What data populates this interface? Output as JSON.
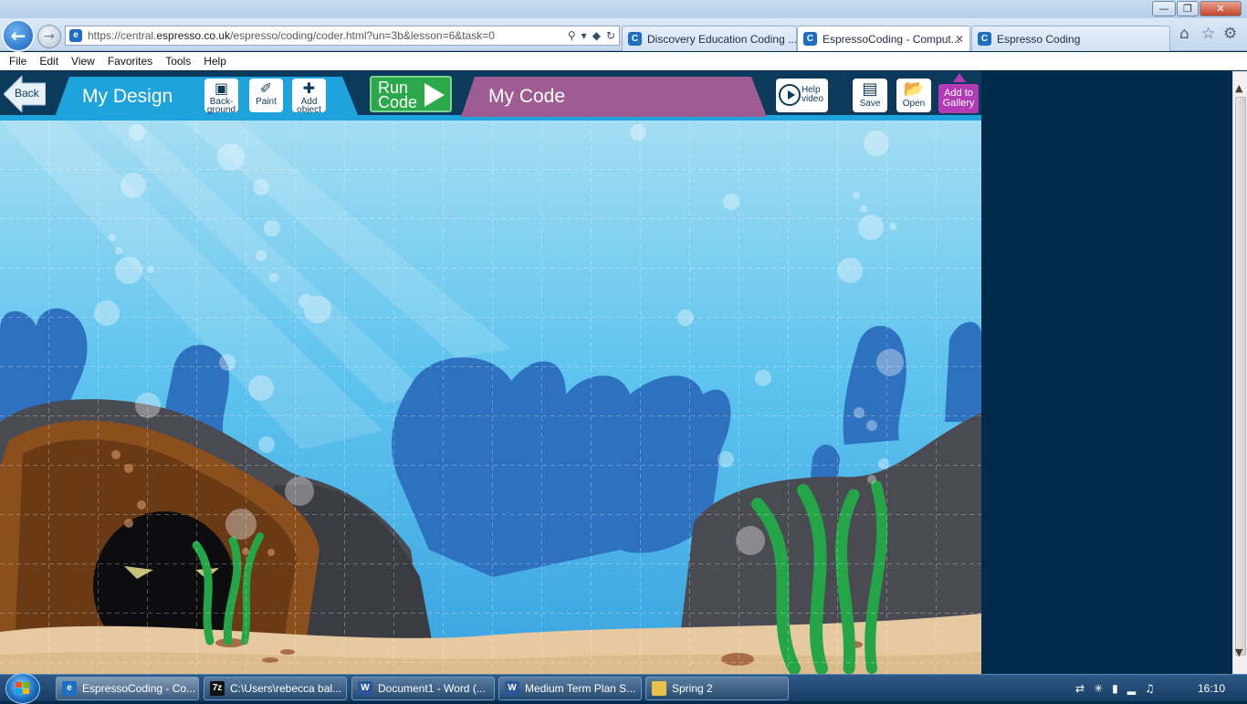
{
  "browser": {
    "url_prefix": "https://central.",
    "url_domain": "espresso.co.uk",
    "url_path": "/espresso/coding/coder.html?un=3b&lesson=6&task=0",
    "tabs": [
      {
        "label": "Discovery Education Coding ..."
      },
      {
        "label": "EspressoCoding - Comput...",
        "active": true
      },
      {
        "label": "Espresso Coding"
      }
    ],
    "window_buttons": {
      "minimize": "—",
      "restore": "❐",
      "close": "✕"
    }
  },
  "menu": [
    "File",
    "Edit",
    "View",
    "Favorites",
    "Tools",
    "Help"
  ],
  "app": {
    "back_label": "Back",
    "design_tab": "My Design",
    "tools": [
      {
        "line1": "Back-",
        "line2": "ground",
        "icon": "picture-icon"
      },
      {
        "line1": "Paint",
        "line2": "",
        "icon": "paintbrush-icon"
      },
      {
        "line1": "Add",
        "line2": "object",
        "icon": "plus-icon"
      }
    ],
    "run_line1": "Run",
    "run_line2": "Code",
    "code_tab": "My Code",
    "help_line1": "Help",
    "help_line2": "video",
    "save_label": "Save",
    "open_label": "Open",
    "gallery_line1": "Add to",
    "gallery_line2": "Gallery",
    "colors": {
      "toolbar": "#0b3a5c",
      "design": "#1ea3dc",
      "code": "#9f5c93",
      "run": "#2aa84a",
      "gallery": "#b43bb6"
    }
  },
  "taskbar": {
    "items": [
      {
        "label": "EspressoCoding - Co...",
        "icon": "ie-icon",
        "active": true
      },
      {
        "label": "C:\\Users\\rebecca bal...",
        "icon": "7zip-icon"
      },
      {
        "label": "Document1 - Word (...",
        "icon": "word-icon"
      },
      {
        "label": "Medium Term Plan S...",
        "icon": "word-icon"
      },
      {
        "label": "Spring 2",
        "icon": "folder-icon"
      }
    ],
    "clock": "16:10"
  }
}
